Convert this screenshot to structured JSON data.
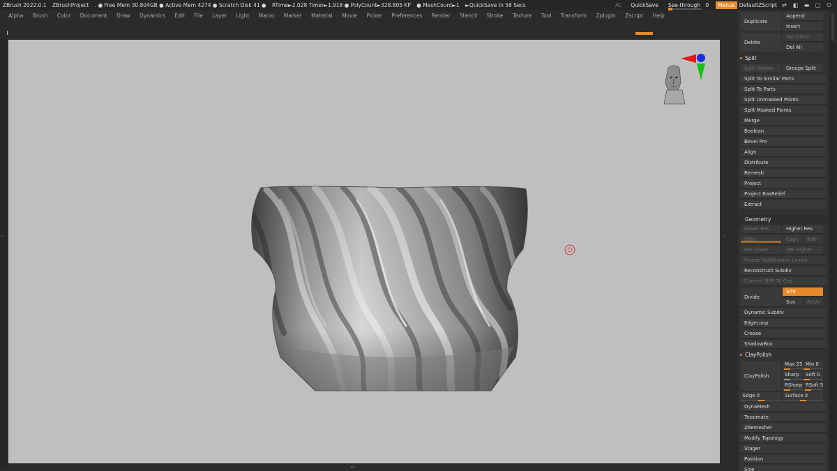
{
  "titlebar": {
    "items": [
      "ZBrush 2022.0.1",
      "ZBrushProject",
      ". ● Free Mem 30.804GB ● Active Mem 4274 ● Scratch Disk 41 ●",
      "RTime►2.028 Timer►1.918 ● PolyCount►328.805 KP",
      "● MeshCount►1",
      "►QuickSave In 58 Secs"
    ],
    "ac": "AC",
    "quicksave": "QuickSave",
    "see_through_label": "See-through",
    "see_through_value": "0",
    "see_through_level": 0,
    "menus": "Menus",
    "script": "DefaultZScript"
  },
  "menubar": [
    "Alpha",
    "Brush",
    "Color",
    "Document",
    "Draw",
    "Dynamics",
    "Edit",
    "File",
    "Layer",
    "Light",
    "Macro",
    "Marker",
    "Material",
    "Movie",
    "Picker",
    "Preferences",
    "Render",
    "Stencil",
    "Stroke",
    "Texture",
    "Tool",
    "Transform",
    "Zplugin",
    "Zscript",
    "Help"
  ],
  "panel": {
    "duplicate": "Duplicate",
    "append": "Append",
    "insert": "Insert",
    "delete": "Delete",
    "del_other": "Del Other",
    "del_all": "Del All",
    "split_header": "Split",
    "split_hidden": "Split Hidden",
    "groups_split": "Groups Split",
    "split_similar": "Split To Similar Parts",
    "split_parts": "Split To Parts",
    "split_unmasked": "Split Unmasked Points",
    "split_masked": "Split Masked Points",
    "merge": "Merge",
    "boolean": "Boolean",
    "bevel_pro": "Bevel Pro",
    "align": "Align",
    "distribute": "Distribute",
    "remesh": "Remesh",
    "project": "Project",
    "project_basrelief": "Project BasRelief",
    "extract": "Extract",
    "geometry_header": "Geometry",
    "lower_res": "Lower Res",
    "higher_res": "Higher Res",
    "sdiv": "SDiv",
    "cage": "Cage",
    "rstr": "Rstr",
    "del_lower": "Del Lower",
    "del_higher": "Del Higher",
    "freeze_subdiv": "Freeze SubDivision Levels",
    "reconstruct_subdiv": "Reconstruct Subdiv",
    "convert_bpr": "Convert BPR To Geo",
    "divide": "Divide",
    "smt": "Smt",
    "suv": "Suv",
    "reuv": "ReUV",
    "dynamic_subdiv": "Dynamic Subdiv",
    "edgeloop": "EdgeLoop",
    "crease": "Crease",
    "shadowbox": "ShadowBox",
    "claypolish_header": "ClayPolish",
    "claypolish": "ClayPolish",
    "max_label": "Max",
    "max_value": "25",
    "min_label": "Min",
    "min_value": "0",
    "sharp_label": "Sharp",
    "soft_label": "Soft",
    "soft_value": "0",
    "rsharp_label": "RSharp",
    "rsoft_label": "RSoft",
    "rsoft_value": "5",
    "edge_label": "Edge",
    "edge_value": "0",
    "surface_label": "Surface",
    "surface_value": "0",
    "dynamesh": "DynaMesh",
    "tessimate": "Tessimate",
    "zremesher": "ZRemesher",
    "modify_topology": "Modify Topology",
    "stager": "Stager",
    "position": "Position",
    "size": "Size"
  },
  "colors": {
    "accent": "#e8892a",
    "canvas": "#bfbfbf",
    "panel": "#323232",
    "axis_x": "#e01818",
    "axis_y": "#18c018",
    "axis_z": "#1830e0"
  },
  "icons": [
    "head-navigation-icon",
    "axis-gizmo-icon",
    "brush-cursor-icon"
  ]
}
